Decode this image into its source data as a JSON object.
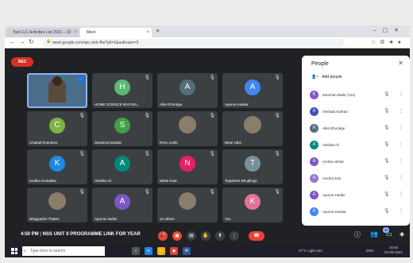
{
  "browser": {
    "tabs": [
      {
        "label": "Tool 1LC Activities List 2021 – 22"
      },
      {
        "label": "Meet"
      }
    ],
    "url": "meet.google.com/qec-jnrb-fhe?pli=1&authuser=3"
  },
  "meet": {
    "rec_label": "REC",
    "time": "4:50 PM",
    "separator": "|",
    "meeting_title": "NSS UNIT II PROGRAMME LINK FOR YEAR",
    "participant_count": "30",
    "tiles": [
      {
        "name": "",
        "initial": "",
        "color": "#4a6e8a",
        "type": "self"
      },
      {
        "name": "HOME SCIENCE BACHEL...",
        "initial": "H",
        "color": "#5bb974"
      },
      {
        "name": "Alka Dhondge",
        "initial": "A",
        "color": "#546e7a"
      },
      {
        "name": "Apurva Kaokar",
        "initial": "A",
        "color": "#4285f4"
      },
      {
        "name": "Chaitali Khankure",
        "initial": "C",
        "color": "#7cb342"
      },
      {
        "name": "Sanskruti Bobale",
        "initial": "S",
        "color": "#43a047"
      },
      {
        "name": "Renu Joshi",
        "initial": "",
        "color": "#3c4043",
        "type": "photo"
      },
      {
        "name": "Betul zakir",
        "initial": "",
        "color": "#3c4043",
        "type": "photo"
      },
      {
        "name": "Krutika Sontakke",
        "initial": "K",
        "color": "#1e88e5"
      },
      {
        "name": "Akshita Ali",
        "initial": "A",
        "color": "#00897b"
      },
      {
        "name": "Nikita Kute",
        "initial": "N",
        "color": "#e91e63"
      },
      {
        "name": "Tejashree Bhujbhuje",
        "initial": "T",
        "color": "#78909c"
      },
      {
        "name": "Bhagyashri Thakre",
        "initial": "",
        "color": "#3c4043",
        "type": "photo"
      },
      {
        "name": "Apurva Hadke",
        "initial": "A",
        "color": "#7e57c2"
      },
      {
        "name": "14 others",
        "initial": "",
        "color": "#3c4043",
        "type": "photo"
      },
      {
        "name": "You",
        "initial": "K",
        "color": "#e57399"
      }
    ]
  },
  "panel": {
    "title": "People",
    "close": "✕",
    "add_people": "Add people",
    "people": [
      {
        "name": "Kanchan Bade (You)",
        "initial": "K",
        "color": "#7e57c2"
      },
      {
        "name": "Akshata Kothari",
        "initial": "A",
        "color": "#3f51b5"
      },
      {
        "name": "Alka Dhondge",
        "initial": "A",
        "color": "#546e7a"
      },
      {
        "name": "Akshita Ali",
        "initial": "A",
        "color": "#00897b"
      },
      {
        "name": "Amrita Akhtar",
        "initial": "A",
        "color": "#7e57c2"
      },
      {
        "name": "Anchal Jain",
        "initial": "A",
        "color": "#9575cd"
      },
      {
        "name": "Apurva Hadke",
        "initial": "A",
        "color": "#7e57c2"
      },
      {
        "name": "Apurva Kaokar",
        "initial": "A",
        "color": "#4285f4"
      }
    ]
  },
  "taskbar": {
    "search_placeholder": "Type here to search",
    "weather": "27°C  Light rain",
    "lang": "ENG",
    "time": "16:50",
    "date": "03-09-2021"
  }
}
